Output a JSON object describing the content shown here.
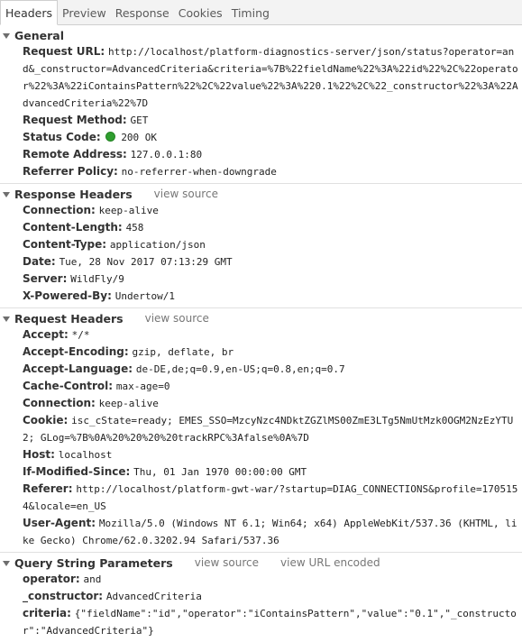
{
  "tabs": [
    "Headers",
    "Preview",
    "Response",
    "Cookies",
    "Timing"
  ],
  "general": {
    "title": "General",
    "rows": [
      {
        "key": "Request URL:",
        "value": "http://localhost/platform-diagnostics-server/json/status?operator=and&_constructor=AdvancedCriteria&criteria=%7B%22fieldName%22%3A%22id%22%2C%22operator%22%3A%22iContainsPattern%22%2C%22value%22%3A%220.1%22%2C%22_constructor%22%3A%22AdvancedCriteria%22%7D"
      },
      {
        "key": "Request Method:",
        "value": "GET"
      },
      {
        "key": "Status Code:",
        "value": "200 OK"
      },
      {
        "key": "Remote Address:",
        "value": "127.0.0.1:80"
      },
      {
        "key": "Referrer Policy:",
        "value": "no-referrer-when-downgrade"
      }
    ]
  },
  "response_headers": {
    "title": "Response Headers",
    "link": "view source",
    "rows": [
      {
        "key": "Connection:",
        "value": "keep-alive"
      },
      {
        "key": "Content-Length:",
        "value": "458"
      },
      {
        "key": "Content-Type:",
        "value": "application/json"
      },
      {
        "key": "Date:",
        "value": "Tue, 28 Nov 2017 07:13:29 GMT"
      },
      {
        "key": "Server:",
        "value": "WildFly/9"
      },
      {
        "key": "X-Powered-By:",
        "value": "Undertow/1"
      }
    ]
  },
  "request_headers": {
    "title": "Request Headers",
    "link": "view source",
    "rows": [
      {
        "key": "Accept:",
        "value": "*/*"
      },
      {
        "key": "Accept-Encoding:",
        "value": "gzip, deflate, br"
      },
      {
        "key": "Accept-Language:",
        "value": "de-DE,de;q=0.9,en-US;q=0.8,en;q=0.7"
      },
      {
        "key": "Cache-Control:",
        "value": "max-age=0"
      },
      {
        "key": "Connection:",
        "value": "keep-alive"
      },
      {
        "key": "Cookie:",
        "value": "isc_cState=ready; EMES_SSO=MzcyNzc4NDktZGZlMS00ZmE3LTg5NmUtMzk0OGM2NzEzYTU2; GLog=%7B%0A%20%20%20%20trackRPC%3Afalse%0A%7D"
      },
      {
        "key": "Host:",
        "value": "localhost"
      },
      {
        "key": "If-Modified-Since:",
        "value": "Thu, 01 Jan 1970 00:00:00 GMT"
      },
      {
        "key": "Referer:",
        "value": "http://localhost/platform-gwt-war/?startup=DIAG_CONNECTIONS&profile=1705154&locale=en_US"
      },
      {
        "key": "User-Agent:",
        "value": "Mozilla/5.0 (Windows NT 6.1; Win64; x64) AppleWebKit/537.36 (KHTML, like Gecko) Chrome/62.0.3202.94 Safari/537.36"
      }
    ]
  },
  "query_params": {
    "title": "Query String Parameters",
    "link": "view source",
    "link2": "view URL encoded",
    "rows": [
      {
        "key": "operator:",
        "value": "and"
      },
      {
        "key": "_constructor:",
        "value": "AdvancedCriteria"
      },
      {
        "key": "criteria:",
        "value": "{\"fieldName\":\"id\",\"operator\":\"iContainsPattern\",\"value\":\"0.1\",\"_constructor\":\"AdvancedCriteria\"}"
      }
    ]
  },
  "colors": {
    "status_ok": "#2f9e2f"
  }
}
